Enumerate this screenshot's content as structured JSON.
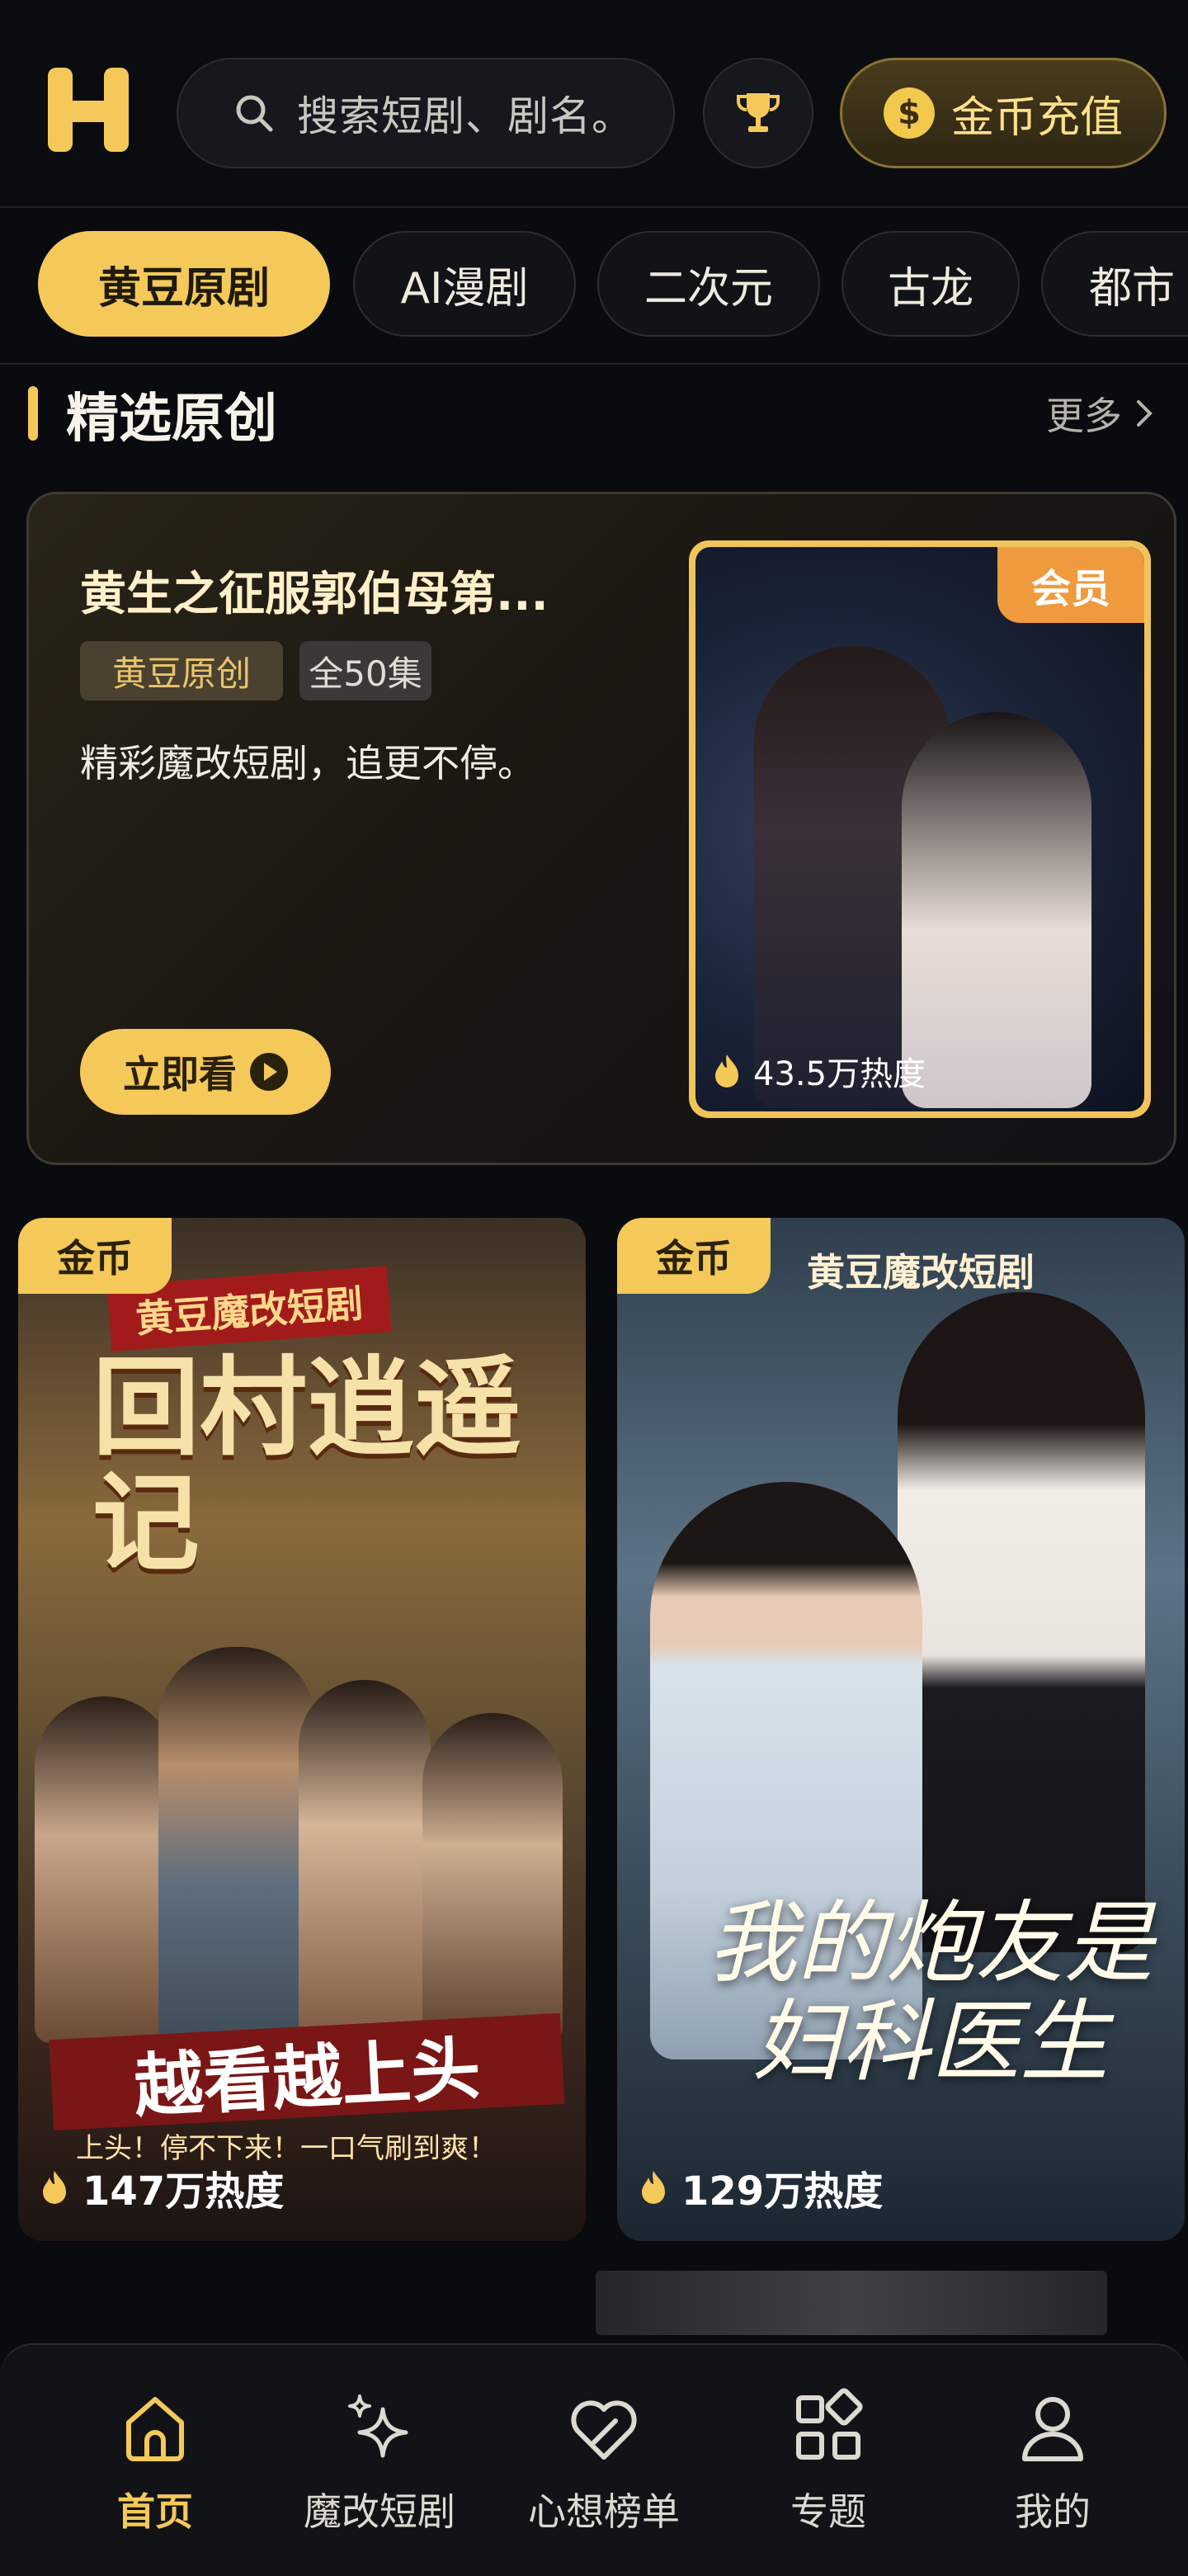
{
  "header": {
    "search_placeholder": "搜索短剧、剧名。",
    "coin_button": "金币充值",
    "coin_symbol": "$"
  },
  "tabs": [
    {
      "label": "黄豆原剧",
      "active": true
    },
    {
      "label": "AI漫剧",
      "active": false
    },
    {
      "label": "二次元",
      "active": false
    },
    {
      "label": "古龙",
      "active": false
    },
    {
      "label": "都市",
      "active": false
    }
  ],
  "section": {
    "title": "精选原创",
    "more": "更多"
  },
  "featured": {
    "title": "黄生之征服郭伯母第...",
    "tag_brand": "黄豆原创",
    "tag_episodes": "全50集",
    "description": "精彩魔改短剧，追更不停。",
    "watch_button": "立即看",
    "badge": "会员",
    "heat": "43.5万热度"
  },
  "grid": [
    {
      "badge": "金币",
      "brand": "黄豆魔改短剧",
      "title": "回村逍遥记",
      "slogan": "越看越上头",
      "sub": "上头！停不下来！一口气刷到爽！",
      "heat": "147万热度"
    },
    {
      "badge": "金币",
      "brand": "黄豆魔改短剧",
      "title": "我的炮友是妇科医生",
      "heat": "129万热度"
    }
  ],
  "nav": [
    {
      "label": "首页",
      "icon": "home-icon",
      "active": true
    },
    {
      "label": "魔改短剧",
      "icon": "sparkle-icon",
      "active": false
    },
    {
      "label": "心想榜单",
      "icon": "heart-icon",
      "active": false
    },
    {
      "label": "专题",
      "icon": "grid-icon",
      "active": false
    },
    {
      "label": "我的",
      "icon": "user-icon",
      "active": false
    }
  ],
  "colors": {
    "accent": "#f4c95a",
    "background": "#0a0b0f",
    "vip": "#f09a3e"
  }
}
